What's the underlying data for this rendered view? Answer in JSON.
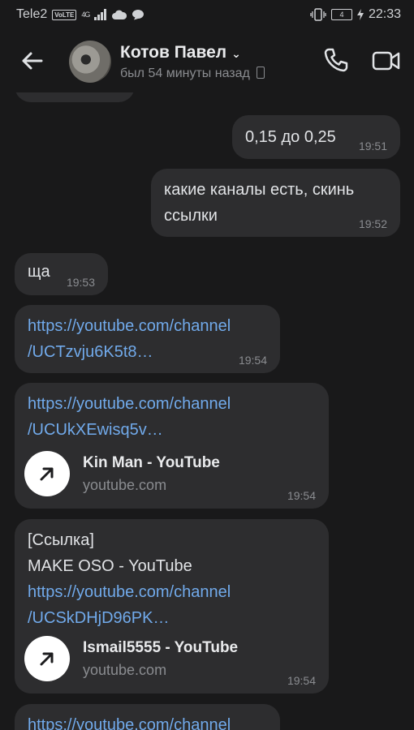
{
  "status_bar": {
    "carrier": "Tele2",
    "volte": "VoLTE",
    "network": "4G",
    "battery": "4",
    "time": "22:33"
  },
  "header": {
    "name": "Котов Павел",
    "last_seen": "был 54 минуты назад"
  },
  "messages": [
    {
      "direction": "out",
      "text": "0,15 до 0,25",
      "time": "19:51"
    },
    {
      "direction": "out",
      "text_line1": "какие каналы есть, скинь",
      "text_line2": "ссылки",
      "time": "19:52"
    },
    {
      "direction": "in",
      "text": "ща",
      "time": "19:53"
    },
    {
      "direction": "in",
      "link_line1": "https://youtube.com/channel",
      "link_line2": "/UCTzvju6K5t8…",
      "time": "19:54"
    },
    {
      "direction": "in",
      "link_line1": "https://youtube.com/channel",
      "link_line2": "/UCUkXEwisq5v…",
      "preview_title": "Kin Man - YouTube",
      "preview_site": "youtube.com",
      "time": "19:54"
    },
    {
      "direction": "in",
      "text_line1": "[Ссылка]",
      "text_line2": "MAKE OSO - YouTube",
      "link_line1": "https://youtube.com/channel",
      "link_line2": "/UCSkDHjD96PK…",
      "preview_title": "Ismail5555 - YouTube",
      "preview_site": "youtube.com",
      "time": "19:54"
    },
    {
      "direction": "in",
      "link_line1": "https://youtube.com/channel"
    }
  ]
}
